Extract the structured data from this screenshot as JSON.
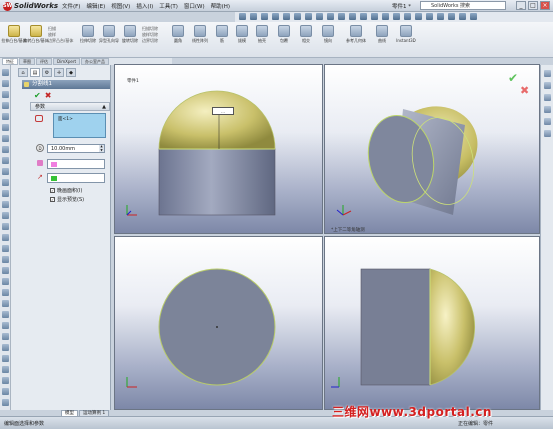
{
  "app": {
    "name": "SolidWorks",
    "logo_letters": "SW",
    "document": "零件1 *"
  },
  "menu": [
    "文件(F)",
    "编辑(E)",
    "视图(V)",
    "插入(I)",
    "工具(T)",
    "窗口(W)",
    "帮助(H)"
  ],
  "search": {
    "placeholder": "SolidWorks 搜索"
  },
  "window_buttons": [
    "_",
    "□",
    "×"
  ],
  "ribbon": {
    "buttons": [
      "拉伸凸台/基体",
      "旋转凸台/基体",
      "扫描",
      "放样凸台/基体",
      "拉伸切除",
      "异型孔向导",
      "旋转切除",
      "圆角",
      "线性阵列",
      "筋",
      "拔模",
      "抽壳",
      "包覆",
      "相交",
      "镜向",
      "参考几何体",
      "曲线",
      "Instant3D"
    ],
    "small_items": [
      "扫描",
      "放样",
      "边界凸台/基体",
      "扫描切除",
      "放样切除",
      "边界切除"
    ]
  },
  "cm_tabs": [
    "特征",
    "草图",
    "评估",
    "DimXpert",
    "办公室产品"
  ],
  "feature": {
    "title": "分割线1",
    "ok": "✔",
    "cancel": "✖",
    "section": "参数",
    "collapse": "▲",
    "selection": "面<1>",
    "distance": "10.00mm",
    "distance_icon": "D",
    "spin_up": "▲",
    "spin_down": "▼",
    "pen": "↗",
    "check_mark": "✓",
    "options": [
      "晚画面积(I)",
      "显示预览(S)"
    ]
  },
  "panel_tabs": [
    "FeatureManager",
    "PropertyManager",
    "ConfigurationManager",
    "DimXpertManager",
    "DisplayManager"
  ],
  "bottom_tabs": [
    "模型",
    "运动算例 1"
  ],
  "status": {
    "left": "编辑面选择和参数",
    "right": "正在编辑：零件"
  },
  "viewports": {
    "top_left_label": "零件1",
    "top_right_label": "*上下二等角轴测",
    "tooltip": "..."
  },
  "watermark": "三维网www.3dportal.cn",
  "accent": {
    "dome_yellow": "#c9c06a",
    "body_blue": "#8a92a8",
    "feature_header": "#6e86a4",
    "watermark_red": "#d42020"
  }
}
